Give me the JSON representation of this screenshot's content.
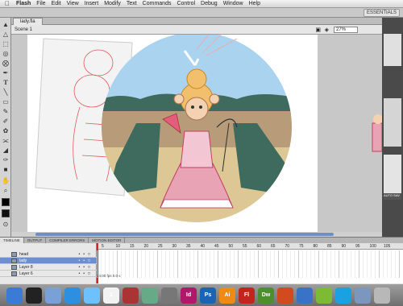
{
  "menubar": {
    "apple": "",
    "items": [
      "Flash",
      "File",
      "Edit",
      "View",
      "Insert",
      "Modify",
      "Text",
      "Commands",
      "Control",
      "Debug",
      "Window",
      "Help"
    ]
  },
  "workspace": {
    "label": "ESSENTIALS"
  },
  "document": {
    "tab": "lady.fla",
    "scene": "Scene 1",
    "zoom": "27%"
  },
  "timeline": {
    "tabs": [
      "TIMELINE",
      "OUTPUT",
      "COMPILER ERRORS",
      "MOTION EDITOR"
    ],
    "layers": [
      {
        "name": "head"
      },
      {
        "name": "lady"
      },
      {
        "name": "Layer 8"
      },
      {
        "name": "Layer 6"
      }
    ],
    "frame_numbers": [
      "5",
      "10",
      "15",
      "20",
      "25",
      "30",
      "35",
      "40",
      "45",
      "50",
      "55",
      "60",
      "65",
      "70",
      "75",
      "80",
      "85",
      "90",
      "95",
      "100",
      "105"
    ],
    "footer": "24.00 fps  0.0 s"
  },
  "right_panel": {
    "label": "AUTO SAV"
  },
  "dock": {
    "apps": [
      {
        "icon": "finder-icon",
        "label": "",
        "color": "#3a7bd5"
      },
      {
        "icon": "dashboard-icon",
        "label": "",
        "color": "#222"
      },
      {
        "icon": "mail-icon",
        "label": "",
        "color": "#7aa0d8"
      },
      {
        "icon": "safari-icon",
        "label": "",
        "color": "#2d8fe0"
      },
      {
        "icon": "itunes-icon",
        "label": "",
        "color": "#6ec1ff"
      },
      {
        "icon": "ical-icon",
        "label": "1",
        "color": "#f2f2f2"
      },
      {
        "icon": "photo-icon",
        "label": "",
        "color": "#a33"
      },
      {
        "icon": "preview-icon",
        "label": "",
        "color": "#6a8"
      },
      {
        "icon": "preferences-icon",
        "label": "",
        "color": "#777"
      },
      {
        "icon": "indesign-icon",
        "label": "Id",
        "color": "#b0186a"
      },
      {
        "icon": "photoshop-icon",
        "label": "Ps",
        "color": "#1b64b5"
      },
      {
        "icon": "illustrator-icon",
        "label": "Ai",
        "color": "#f08a17"
      },
      {
        "icon": "flash-icon",
        "label": "Fl",
        "color": "#c3241e"
      },
      {
        "icon": "dreamweaver-icon",
        "label": "Dw",
        "color": "#4d8f2c"
      },
      {
        "icon": "app-icon",
        "label": "",
        "color": "#d14b1f"
      },
      {
        "icon": "word-icon",
        "label": "",
        "color": "#3973c7"
      },
      {
        "icon": "spotify-icon",
        "label": "",
        "color": "#7cbb33"
      },
      {
        "icon": "skype-icon",
        "label": "",
        "color": "#1aa1e2"
      },
      {
        "icon": "folder-icon",
        "label": "",
        "color": "#7b97bd"
      },
      {
        "icon": "trash-icon",
        "label": "",
        "color": "#b8b8b8"
      }
    ]
  }
}
